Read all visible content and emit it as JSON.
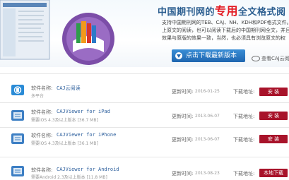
{
  "banner": {
    "headline_prefix": "中国期刊网的",
    "headline_highlight": "专用",
    "headline_suffix": "全文格式阅",
    "intro_lines": [
      "支持中国期刊网的TEB、CAJ、NH、KDH和PDF格式文件。可",
      "上原文的阅读，也可以阅读下载后的中国期刊网全文，并且",
      "效果与原版的效果一致，当然，也必须具有浏览原文的权"
    ],
    "download_button": "点击下载最新版本",
    "view_link": "查看CAJ云阅"
  },
  "products": [
    {
      "name_label": "软件名称:",
      "name": "CAJ云阅读",
      "sub_text": "多平台",
      "date_label": "更新时间:",
      "date": "2016-01-25",
      "dl_label": "下载地址:",
      "button": "安 装",
      "icon_color": "#2a8bd6"
    },
    {
      "name_label": "软件名称:",
      "name": "CAJViewer for iPad",
      "sub_text": "需要iOS 4.3及以上版本 [36.7 MB]",
      "date_label": "更新时间:",
      "date": "2013-06-07",
      "dl_label": "下载地址:",
      "button": "安 装",
      "icon_color": "#3d7fc4"
    },
    {
      "name_label": "软件名称:",
      "name": "CAJViewer for iPhone",
      "sub_text": "需要iOS 4.3及以上版本 [36.1 MB]",
      "date_label": "更新时间:",
      "date": "2013-06-07",
      "dl_label": "下载地址:",
      "button": "安 装",
      "icon_color": "#3d7fc4"
    },
    {
      "name_label": "软件名称:",
      "name": "CAJViewer for Android",
      "sub_text": "需要Android 2.3及以上版本 [11.8 MB]",
      "date_label": "更新时间:",
      "date": "2013-08-23",
      "dl_label": "下载地址:",
      "button": "本地下载",
      "icon_color": "#3d7fc4"
    }
  ],
  "colors": {
    "accent": "#2a5d8f",
    "highlight": "#e31b23",
    "button": "#a8132a"
  }
}
